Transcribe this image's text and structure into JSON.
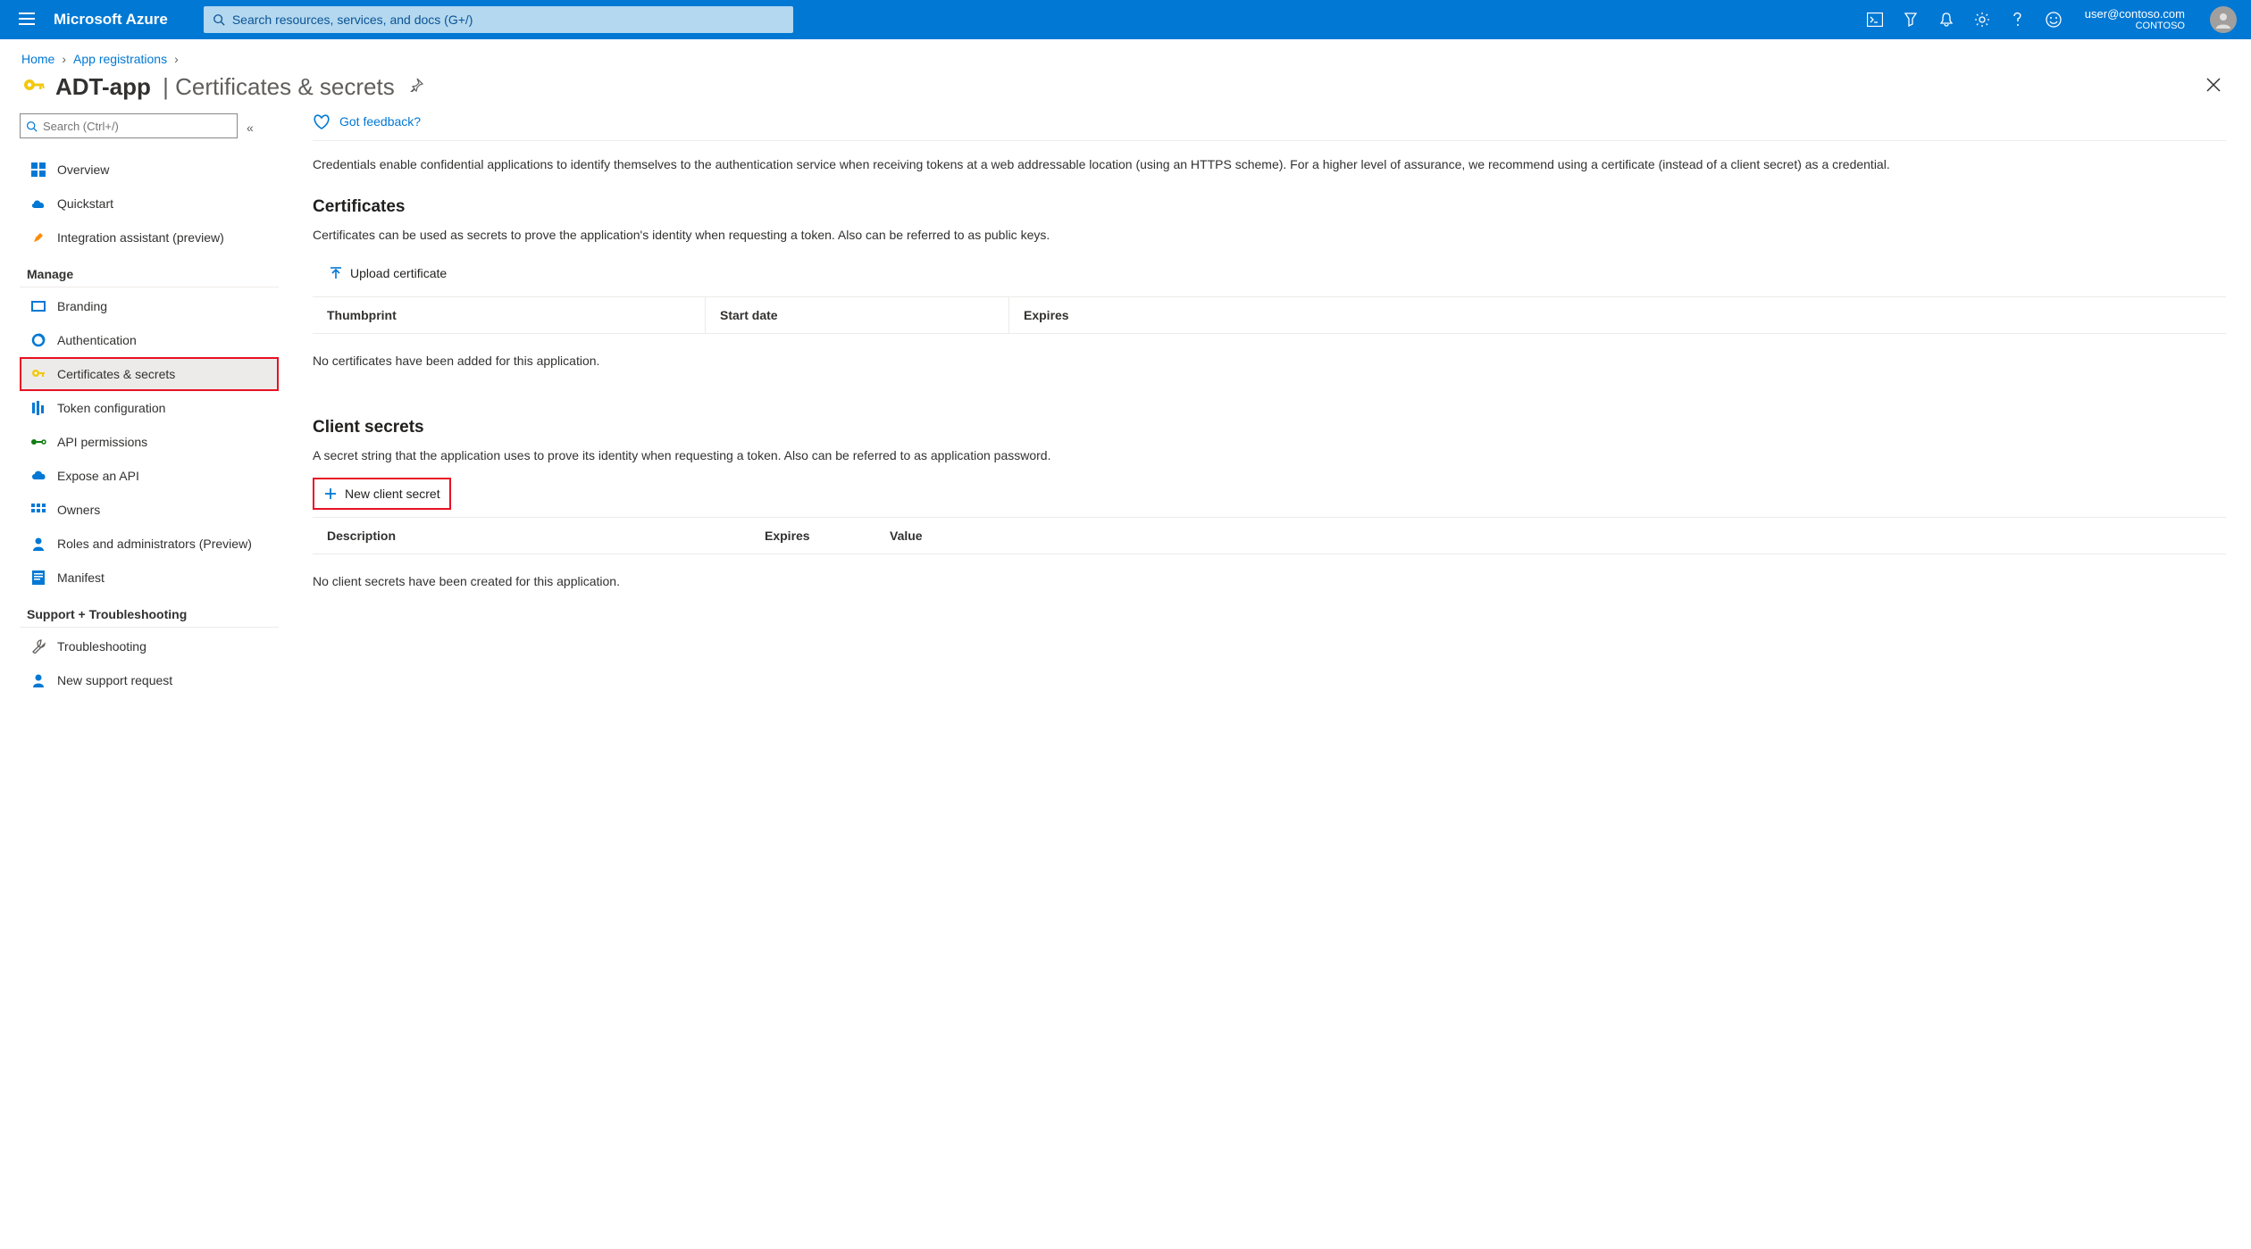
{
  "header": {
    "brand": "Microsoft Azure",
    "search_placeholder": "Search resources, services, and docs (G+/)",
    "user_email": "user@contoso.com",
    "tenant": "CONTOSO"
  },
  "breadcrumb": {
    "home": "Home",
    "appreg": "App registrations"
  },
  "page": {
    "title": "ADT-app",
    "subtitle": "Certificates & secrets"
  },
  "sidebar": {
    "search_placeholder": "Search (Ctrl+/)",
    "items_top": [
      {
        "label": "Overview"
      },
      {
        "label": "Quickstart"
      },
      {
        "label": "Integration assistant (preview)"
      }
    ],
    "section_manage": "Manage",
    "items_manage": [
      {
        "label": "Branding"
      },
      {
        "label": "Authentication"
      },
      {
        "label": "Certificates & secrets"
      },
      {
        "label": "Token configuration"
      },
      {
        "label": "API permissions"
      },
      {
        "label": "Expose an API"
      },
      {
        "label": "Owners"
      },
      {
        "label": "Roles and administrators (Preview)"
      },
      {
        "label": "Manifest"
      }
    ],
    "section_support": "Support + Troubleshooting",
    "items_support": [
      {
        "label": "Troubleshooting"
      },
      {
        "label": "New support request"
      }
    ]
  },
  "main": {
    "feedback": "Got feedback?",
    "intro": "Credentials enable confidential applications to identify themselves to the authentication service when receiving tokens at a web addressable location (using an HTTPS scheme). For a higher level of assurance, we recommend using a certificate (instead of a client secret) as a credential.",
    "certificates": {
      "heading": "Certificates",
      "desc": "Certificates can be used as secrets to prove the application's identity when requesting a token. Also can be referred to as public keys.",
      "upload": "Upload certificate",
      "col_thumbprint": "Thumbprint",
      "col_start": "Start date",
      "col_expires": "Expires",
      "empty": "No certificates have been added for this application."
    },
    "secrets": {
      "heading": "Client secrets",
      "desc": "A secret string that the application uses to prove its identity when requesting a token. Also can be referred to as application password.",
      "new": "New client secret",
      "col_desc": "Description",
      "col_expires": "Expires",
      "col_value": "Value",
      "empty": "No client secrets have been created for this application."
    }
  }
}
